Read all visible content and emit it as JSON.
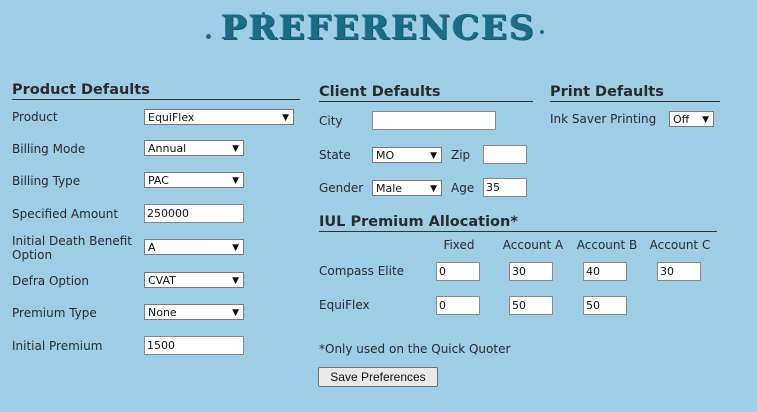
{
  "page": {
    "title": "PREFERENCES"
  },
  "product_defaults": {
    "heading": "Product Defaults",
    "product": {
      "label": "Product",
      "value": "EquiFlex"
    },
    "billing_mode": {
      "label": "Billing Mode",
      "value": "Annual"
    },
    "billing_type": {
      "label": "Billing Type",
      "value": "PAC"
    },
    "specified_amount": {
      "label": "Specified Amount",
      "value": "250000"
    },
    "initial_death_benefit": {
      "label": "Initial Death Benefit Option",
      "value": "A"
    },
    "defra_option": {
      "label": "Defra Option",
      "value": "CVAT"
    },
    "premium_type": {
      "label": "Premium Type",
      "value": "None"
    },
    "initial_premium": {
      "label": "Initial Premium",
      "value": "1500"
    }
  },
  "client_defaults": {
    "heading": "Client Defaults",
    "city": {
      "label": "City",
      "value": ""
    },
    "state": {
      "label": "State",
      "value": "MO"
    },
    "zip": {
      "label": "Zip",
      "value": ""
    },
    "gender": {
      "label": "Gender",
      "value": "Male"
    },
    "age": {
      "label": "Age",
      "value": "35"
    }
  },
  "print_defaults": {
    "heading": "Print Defaults",
    "ink_saver": {
      "label": "Ink Saver Printing",
      "value": "Off"
    }
  },
  "iul_allocation": {
    "heading": "IUL Premium Allocation*",
    "columns": [
      "Fixed",
      "Account A",
      "Account B",
      "Account C"
    ],
    "rows": [
      {
        "label": "Compass Elite",
        "values": [
          "0",
          "30",
          "40",
          "30"
        ]
      },
      {
        "label": "EquiFlex",
        "values": [
          "0",
          "50",
          "50"
        ]
      }
    ],
    "footnote": "*Only used on the Quick Quoter"
  },
  "actions": {
    "save_label": "Save Preferences"
  }
}
